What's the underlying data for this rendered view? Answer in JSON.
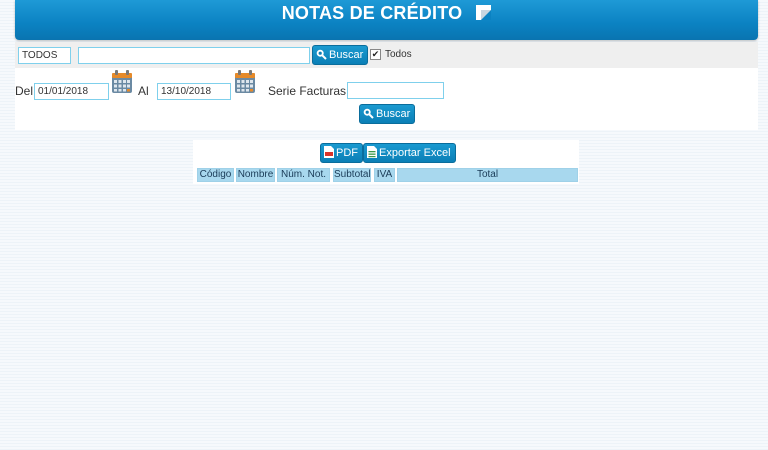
{
  "header": {
    "title": "NOTAS DE CRÉDITO"
  },
  "search": {
    "select_value": "TODOS",
    "text_value": "",
    "button_label": "Buscar",
    "checkbox_label": "Todos",
    "checkbox_checked": true
  },
  "filters": {
    "from_label": "Del",
    "from_value": "01/01/2018",
    "to_label": "Al",
    "to_value": "13/10/2018",
    "serie_label": "Serie Facturas:",
    "serie_value": "",
    "button_label": "Buscar"
  },
  "exports": {
    "pdf_label": "PDF",
    "excel_label": "Exportar Excel"
  },
  "table": {
    "headers": [
      "Código",
      "Nombre",
      "Núm. Not.",
      "Subtotal",
      "IVA",
      "Total"
    ]
  },
  "colors": {
    "header_blue": "#0b82c2",
    "input_border": "#7fd0ec",
    "table_header": "#a8d8ee"
  }
}
